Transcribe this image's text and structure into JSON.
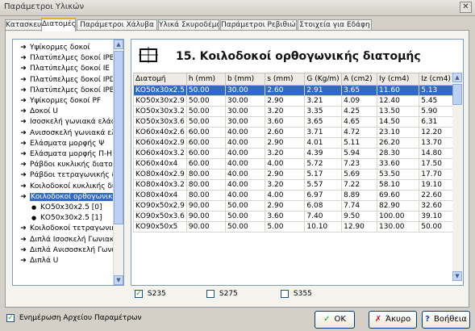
{
  "window": {
    "title": "Παράμετροι Υλικών",
    "close_label": "✕"
  },
  "tabs": [
    {
      "label": "Κατασκευής",
      "active": false
    },
    {
      "label": "Διατομές",
      "active": true
    },
    {
      "label": "Παράμετροι Χάλυβα",
      "active": false
    },
    {
      "label": "Υλικά Σκυροδέματος",
      "active": false
    },
    {
      "label": "Παράμετροι Ρεβιθιών",
      "active": false
    },
    {
      "label": "Στοιχεία για Εδάφη",
      "active": false
    }
  ],
  "tree": {
    "items": [
      {
        "label": "Υψίκορμες δοκοί",
        "icon": "arrow"
      },
      {
        "label": "Πλατύπελμες δοκοί IPB",
        "icon": "arrow"
      },
      {
        "label": "Πλατύπελμες δοκοί IE",
        "icon": "arrow"
      },
      {
        "label": "Πλατύπελμες δοκοί IPD",
        "icon": "arrow"
      },
      {
        "label": "Πλατύπελμες δοκοί IPBv",
        "icon": "arrow"
      },
      {
        "label": "Υψίκορμες δοκοί PF",
        "icon": "arrow"
      },
      {
        "label": "Δοκοί U",
        "icon": "arrow"
      },
      {
        "label": "Ισοσκελή γωνιακά ελάσματα",
        "icon": "arrow"
      },
      {
        "label": "Ανισοσκελή γωνιακά ελάσματα",
        "icon": "arrow"
      },
      {
        "label": "Ελάσματα μορφής Ψ",
        "icon": "arrow"
      },
      {
        "label": "Ελάσματα μορφής Π-Η",
        "icon": "arrow"
      },
      {
        "label": "Ράβδοι κυκλικής διατομής",
        "icon": "arrow"
      },
      {
        "label": "Ράβδοι τετραγωνικής διατομής",
        "icon": "arrow"
      },
      {
        "label": "Κοιλοδοκοί κυκλικής διατομής",
        "icon": "arrow-bold"
      },
      {
        "label": "Κοιλοδοκοί ορθογωνικής διατομής",
        "icon": "arrow-bold",
        "selected": true
      },
      {
        "label": "ΚΟ50x30x2.5 [0]",
        "icon": "dot",
        "child": true
      },
      {
        "label": "ΚΟ50x30x2.5 [1]",
        "icon": "dot",
        "child": true
      },
      {
        "label": "Κοιλοδοκοί τετραγωνικής",
        "icon": "arrow"
      },
      {
        "label": "Διπλά Ισοσκελή Γωνιακά",
        "icon": "arrow"
      },
      {
        "label": "Διπλά Ανισοσκελή Γωνιακά",
        "icon": "arrow"
      },
      {
        "label": "Διπλά U",
        "icon": "arrow"
      }
    ]
  },
  "main": {
    "header_icon": "rectangular-tube-section-icon",
    "title": "15. Κοιλοδοκοί ορθογωνικής διατομής",
    "columns": [
      "Διατομή",
      "h (mm)",
      "b (mm)",
      "s (mm)",
      "G (Kg/m)",
      "A (cm2)",
      "Iy (cm4)",
      "Iz (cm4)"
    ],
    "rows": [
      [
        "ΚΟ50x30x2.5",
        "50.00",
        "30.00",
        "2.60",
        "2.91",
        "3.65",
        "11.60",
        "5.13"
      ],
      [
        "ΚΟ50x30x2.9",
        "50.00",
        "30.00",
        "2.90",
        "3.21",
        "4.09",
        "12.40",
        "5.45"
      ],
      [
        "ΚΟ50x30x3.2",
        "50.00",
        "30.00",
        "3.20",
        "3.35",
        "4.25",
        "13.50",
        "5.90"
      ],
      [
        "ΚΟ50x30x3.6",
        "50.00",
        "30.00",
        "3.60",
        "3.65",
        "4.65",
        "14.50",
        "6.31"
      ],
      [
        "ΚΟ60x40x2.6",
        "60.00",
        "40.00",
        "2.60",
        "3.71",
        "4.72",
        "23.10",
        "12.20"
      ],
      [
        "ΚΟ60x40x2.9",
        "60.00",
        "40.00",
        "2.90",
        "4.01",
        "5.11",
        "26.20",
        "13.70"
      ],
      [
        "ΚΟ60x40x3.2",
        "60.00",
        "40.00",
        "3.20",
        "4.39",
        "5.94",
        "28.30",
        "14.80"
      ],
      [
        "ΚΟ60x40x4",
        "60.00",
        "40.00",
        "4.00",
        "5.72",
        "7.23",
        "33.60",
        "17.50"
      ],
      [
        "ΚΟ80x40x2.9",
        "80.00",
        "40.00",
        "2.90",
        "5.17",
        "5.69",
        "53.50",
        "17.70"
      ],
      [
        "ΚΟ80x40x3.2",
        "80.00",
        "40.00",
        "3.20",
        "5.57",
        "7.22",
        "58.10",
        "19.10"
      ],
      [
        "ΚΟ80x40x4",
        "80.00",
        "40.00",
        "4.00",
        "6.97",
        "8.89",
        "69.60",
        "22.60"
      ],
      [
        "ΚΟ90x50x2.9",
        "90.00",
        "50.00",
        "2.90",
        "6.08",
        "7.74",
        "82.90",
        "32.60"
      ],
      [
        "ΚΟ90x50x3.6",
        "90.00",
        "50.00",
        "3.60",
        "7.40",
        "9.50",
        "100.00",
        "39.10"
      ],
      [
        "ΚΟ90x50x5",
        "90.00",
        "50.00",
        "5.00",
        "10.10",
        "12.90",
        "130.00",
        "50.00"
      ]
    ],
    "selected_row": 0
  },
  "grades": [
    {
      "label": "S235",
      "checked": true
    },
    {
      "label": "S275",
      "checked": false
    },
    {
      "label": "S355",
      "checked": false
    }
  ],
  "footer": {
    "update_label": "Ενημέρωση Αρχείου Παραμέτρων",
    "update_checked": true,
    "ok_label": "OK",
    "cancel_label": "Άκυρο",
    "help_label": "Βοήθεια"
  },
  "colors": {
    "accent": "#316ac5",
    "check": "#21a121",
    "ok_icon": "#1f8f1f",
    "cancel_icon": "#c01818",
    "help_icon": "#1b3fbf"
  }
}
